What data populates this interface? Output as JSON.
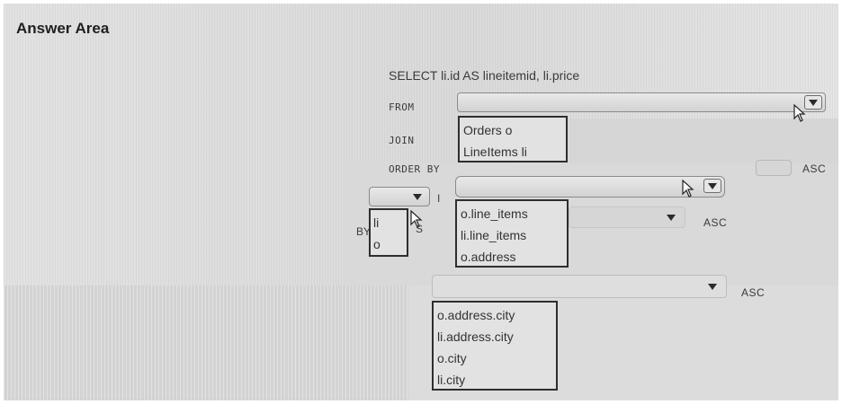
{
  "title": "Answer Area",
  "query": {
    "select_line": "SELECT li.id AS lineitemid, li.price",
    "from_kw": "FROM",
    "join_kw": "JOIN",
    "join_i": "I",
    "order_kw": "ORDER BY",
    "by_kw": "BY",
    "s_fragment": "S"
  },
  "from_options": [
    "Orders o",
    "LineItems li"
  ],
  "alias_options": [
    "li",
    "o"
  ],
  "join_options": [
    "o.line_items",
    "li.line_items",
    "o.address"
  ],
  "order_options": [
    "o.address.city",
    "li.address.city",
    "o.city",
    "li.city"
  ],
  "asc_labels": [
    "ASC",
    "ASC",
    "ASC"
  ],
  "icons": [
    "caret-down-icon",
    "mouse-pointer-icon"
  ]
}
